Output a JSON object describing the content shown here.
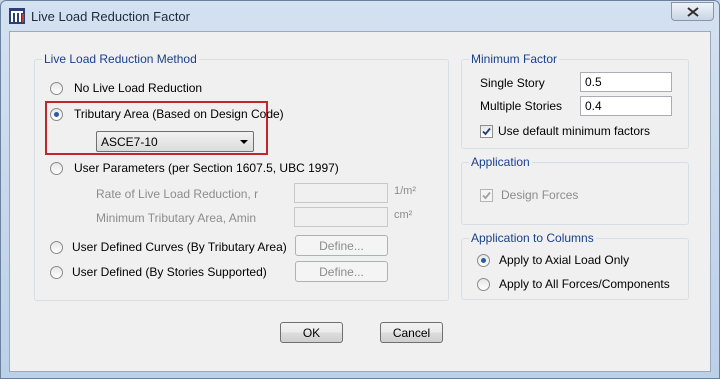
{
  "window": {
    "title": "Live Load Reduction Factor"
  },
  "method": {
    "legend": "Live Load Reduction Method",
    "options": [
      {
        "label": "No Live Load Reduction",
        "selected": false
      },
      {
        "label": "Tributary Area (Based on Design Code)",
        "selected": true
      },
      {
        "label": "User Parameters (per Section 1607.5, UBC 1997)",
        "selected": false
      },
      {
        "label": "User Defined Curves (By Tributary Area)",
        "selected": false
      },
      {
        "label": "User Defined (By Stories Supported)",
        "selected": false
      }
    ],
    "code_select": {
      "value": "ASCE7-10"
    },
    "user_params": {
      "rate_label": "Rate of Live Load Reduction, r",
      "rate_value": "",
      "rate_unit": "1/m²",
      "min_area_label": "Minimum Tributary Area, Amin",
      "min_area_value": "",
      "min_area_unit": "cm²"
    },
    "define_label": "Define..."
  },
  "minimum_factor": {
    "legend": "Minimum Factor",
    "single_story_label": "Single Story",
    "single_story_value": "0.5",
    "multiple_stories_label": "Multiple Stories",
    "multiple_stories_value": "0.4",
    "use_default_label": "Use default minimum factors",
    "use_default_checked": true
  },
  "application": {
    "legend": "Application",
    "design_forces_label": "Design Forces",
    "design_forces_checked": true
  },
  "application_columns": {
    "legend": "Application to Columns",
    "options": [
      {
        "label": "Apply to Axial Load Only",
        "selected": true
      },
      {
        "label": "Apply to All Forces/Components",
        "selected": false
      }
    ]
  },
  "buttons": {
    "ok": "OK",
    "cancel": "Cancel"
  },
  "colors": {
    "legend_text": "#1a3f8c",
    "highlight": "#c0272d",
    "radio_dot": "#2b5aa7"
  }
}
